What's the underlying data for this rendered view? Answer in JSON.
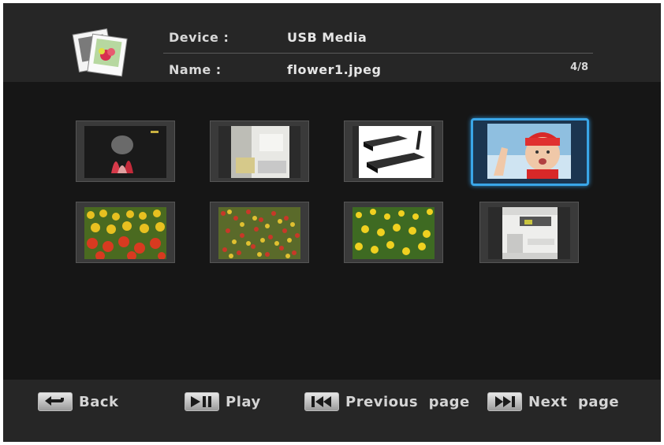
{
  "header": {
    "device_label": "Device :",
    "device_value": "USB Media",
    "name_label": "Name :",
    "name_value": "flower1.jpeg",
    "counter": "4/8"
  },
  "thumbnails": [
    {
      "name": "thumbnail-dark-flower",
      "selected": false
    },
    {
      "name": "thumbnail-kitchen",
      "selected": false
    },
    {
      "name": "thumbnail-set-top-boxes",
      "selected": false
    },
    {
      "name": "thumbnail-baby",
      "selected": true
    },
    {
      "name": "thumbnail-tulips-red-yellow",
      "selected": false
    },
    {
      "name": "thumbnail-tulips-mixed",
      "selected": false
    },
    {
      "name": "thumbnail-tulips-yellow",
      "selected": false
    },
    {
      "name": "thumbnail-living-room",
      "selected": false
    }
  ],
  "footer": {
    "back_label": "Back",
    "play_label": "Play",
    "prev_label": "Previous  page",
    "next_label": "Next  page"
  },
  "colors": {
    "selection": "#3aa6e8",
    "background": "#161616",
    "bar": "#262626"
  }
}
